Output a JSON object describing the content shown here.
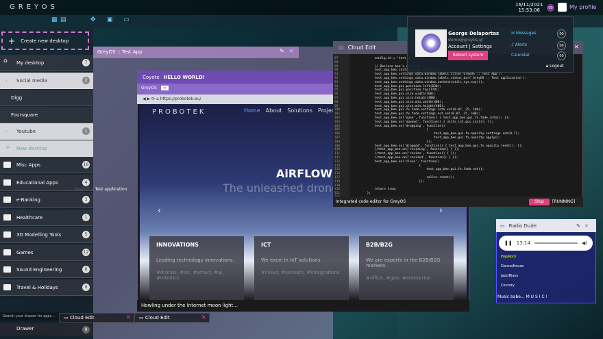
{
  "topbar": {
    "logo": "GREYOS",
    "date": "16/11/2021",
    "time": "15:53:06",
    "badge": "00",
    "profile": "My profile"
  },
  "sidebar": {
    "new_desktop": "Create new desktop",
    "items": [
      {
        "label": "My desktop",
        "count": "7"
      },
      {
        "label": "Social media",
        "count": "2"
      },
      {
        "label": "Digg",
        "count": ""
      },
      {
        "label": "Foursquare",
        "count": ""
      },
      {
        "label": "Youtube",
        "count": "1"
      },
      {
        "label": "New desktop",
        "count": ""
      },
      {
        "label": "Misc Apps",
        "count": "16"
      },
      {
        "label": "Educational Apps",
        "count": "4"
      },
      {
        "label": "e-Banking",
        "count": "3"
      },
      {
        "label": "Healthcare",
        "count": "1"
      },
      {
        "label": "3D Modelling Tools",
        "count": "5"
      },
      {
        "label": "Games",
        "count": "12"
      },
      {
        "label": "Sound Engineering",
        "count": "6"
      },
      {
        "label": "Travel & Holidays",
        "count": "0"
      }
    ],
    "search_placeholder": "Search your drawer for apps...",
    "drawer": "Drawer",
    "drawer_count": "0"
  },
  "pink": {
    "title": "GreyOS :: Test App",
    "sub": "GreyOS :: Test application",
    "hello": "HELLO WORLD!"
  },
  "coyote": {
    "title": "Coyote",
    "tab": "GreyOS",
    "url": "https://probotek.eu/",
    "logo": "PROBOTEK",
    "nav": [
      "Home",
      "About",
      "Solutions",
      "Projects"
    ],
    "hero": "AiRFLOW",
    "tagline": "The unleashed drone",
    "cards": [
      {
        "title": "INNOVATIONS",
        "text": "Leading technology innovations.",
        "tags": "#drones, #iot, #smart, #ai, #robotics",
        "num": "1"
      },
      {
        "title": "ICT",
        "text": "We excel in IoT solutions.",
        "tags": "#cloud, #sensors, #integrations",
        "num": "2"
      },
      {
        "title": "B2B/B2G",
        "text": "We are experts in the B2B/B2G markets.",
        "tags": "#office, #gov, #enterprise",
        "num": "3"
      }
    ],
    "status": "Howling under the Internet moon light..."
  },
  "cloud": {
    "title": "Cloud Edit",
    "status": "Integrated code editor for GreyOS",
    "stop": "Stop",
    "running": "[RUNNING]",
    "code": "            config.id = 'test_app_bee';\n\n            // Declare bee's settings\n            test_app_bee.init(cosmos, config.id, 1);\n            test_app_bee.settings.data.window.labels.title('GreyOS :: Test App');\n            test_app_bee.settings.data.window.labels.status_bar('GreyOS :: Test application');\n            test_app_bee.settings.data.window.content(utils_sys.say());\n            test_app_bee.gui.position.left(630);\n            test_app_bee.gui.position.top(170);\n            test_app_bee.gui.size.width(700);\n            test_app_bee.gui.size.height(400);\n            test_app_bee.gui.size.min.width(400);\n            test_app_bee.gui.size.min.height(400);\n            test_app_bee.gui.fx.fade.settings.into.set(0.07, 25, 100);\n            test_app_bee.gui.fx.fade.settings.out.set(0.07, 25, 100);\n            test_app_bee.on('open', function() { test_app_bee.gui.fx.fade.into(); });\n            test_app_bee.on('opened', function() { utils_int.gui_init(); });\n            test_app_bee.on('dragging', function()\n                                        {\n                                            test_app_bee.gui.fx.opacity.settings.set(0.7);\n                                            test_app_bee.gui.fx.opacity.apply();\n                                        });\n            test_app_bee.on('dragged', function() { test_app_bee.gui.fx.opacity.reset(); });\n            //test_app_bee.on('resizing', function() { });\n            //test_app_bee.on('resize', function() { });\n            //test_app_bee.on('resized', function() { });\n            test_app_bee.on('close', function()\n                                    {\n                                        test_app_bee.gui.fx.fade.out();\n\n                                        caller.reset();\n                                    });\n\n            return true;\n        };",
    "lines": "87\n88\n89\n90\n91\n92\n93\n94\n95\n96\n97\n98\n99\n100\n101\n102\n103\n104\n105\n106\n107\n108\n109\n110\n111\n112\n113\n114\n115\n116\n117\n118\n119\n120\n121\n122\n123"
  },
  "profile": {
    "name": "George Delaportas",
    "email": "demo@greyos.gr",
    "account": "Account | Settings",
    "reboot": "Reboot system",
    "messages": "Messages",
    "alerts": "Alerts",
    "calendar": "Calendar",
    "count": "00",
    "logout": "Logout"
  },
  "radio": {
    "title": "Radio Dude",
    "time": "13:14",
    "stations": [
      "Pop/Rock",
      "Dance/House",
      "Jazz/Blues",
      "Country"
    ],
    "status": "Music babe... M U S I C !"
  },
  "taskbar": [
    "Cloud Edit",
    "Cloud Edit"
  ]
}
